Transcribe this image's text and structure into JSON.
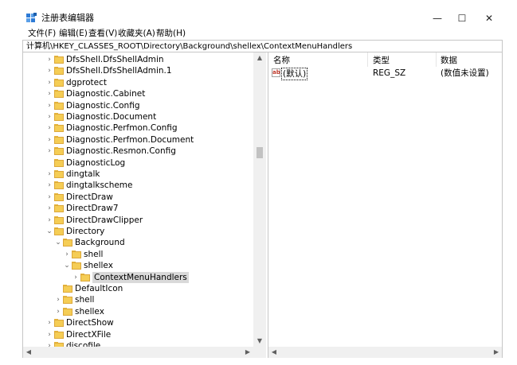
{
  "window": {
    "title": "注册表编辑器",
    "minimize_glyph": "—",
    "maximize_glyph": "☐",
    "close_glyph": "✕"
  },
  "menu": [
    "文件(F)",
    "编辑(E)",
    "查看(V)",
    "收藏夹(A)",
    "帮助(H)"
  ],
  "address": "计算机\\HKEY_CLASSES_ROOT\\Directory\\Background\\shellex\\ContextMenuHandlers",
  "tree": [
    {
      "label": "DfsShell.DfsShellAdmin",
      "expander": "›"
    },
    {
      "label": "DfsShell.DfsShellAdmin.1",
      "expander": "›"
    },
    {
      "label": "dgprotect",
      "expander": "›"
    },
    {
      "label": "Diagnostic.Cabinet",
      "expander": "›"
    },
    {
      "label": "Diagnostic.Config",
      "expander": "›"
    },
    {
      "label": "Diagnostic.Document",
      "expander": "›"
    },
    {
      "label": "Diagnostic.Perfmon.Config",
      "expander": "›"
    },
    {
      "label": "Diagnostic.Perfmon.Document",
      "expander": "›"
    },
    {
      "label": "Diagnostic.Resmon.Config",
      "expander": "›"
    },
    {
      "label": "DiagnosticLog",
      "expander": ""
    },
    {
      "label": "dingtalk",
      "expander": "›"
    },
    {
      "label": "dingtalkscheme",
      "expander": "›"
    },
    {
      "label": "DirectDraw",
      "expander": "›"
    },
    {
      "label": "DirectDraw7",
      "expander": "›"
    },
    {
      "label": "DirectDrawClipper",
      "expander": "›"
    },
    {
      "label": "Directory",
      "expander": "⌄"
    },
    {
      "label": "Background",
      "expander": "⌄"
    },
    {
      "label": "shell",
      "expander": "›"
    },
    {
      "label": "shellex",
      "expander": "⌄"
    },
    {
      "label": "ContextMenuHandlers",
      "expander": "›",
      "selected": true
    },
    {
      "label": "DefaultIcon",
      "expander": ""
    },
    {
      "label": "shell",
      "expander": "›"
    },
    {
      "label": "shellex",
      "expander": "›"
    },
    {
      "label": "DirectShow",
      "expander": "›"
    },
    {
      "label": "DirectXFile",
      "expander": "›"
    },
    {
      "label": "discofile",
      "expander": "›"
    }
  ],
  "values": {
    "columns": {
      "name": "名称",
      "type": "类型",
      "data": "数据"
    },
    "rows": [
      {
        "icon": "ab",
        "name": "(默认)",
        "type": "REG_SZ",
        "data": "(数值未设置)"
      }
    ]
  },
  "scroll": {
    "up": "▲",
    "down": "▼",
    "left": "◀",
    "right": "▶"
  }
}
